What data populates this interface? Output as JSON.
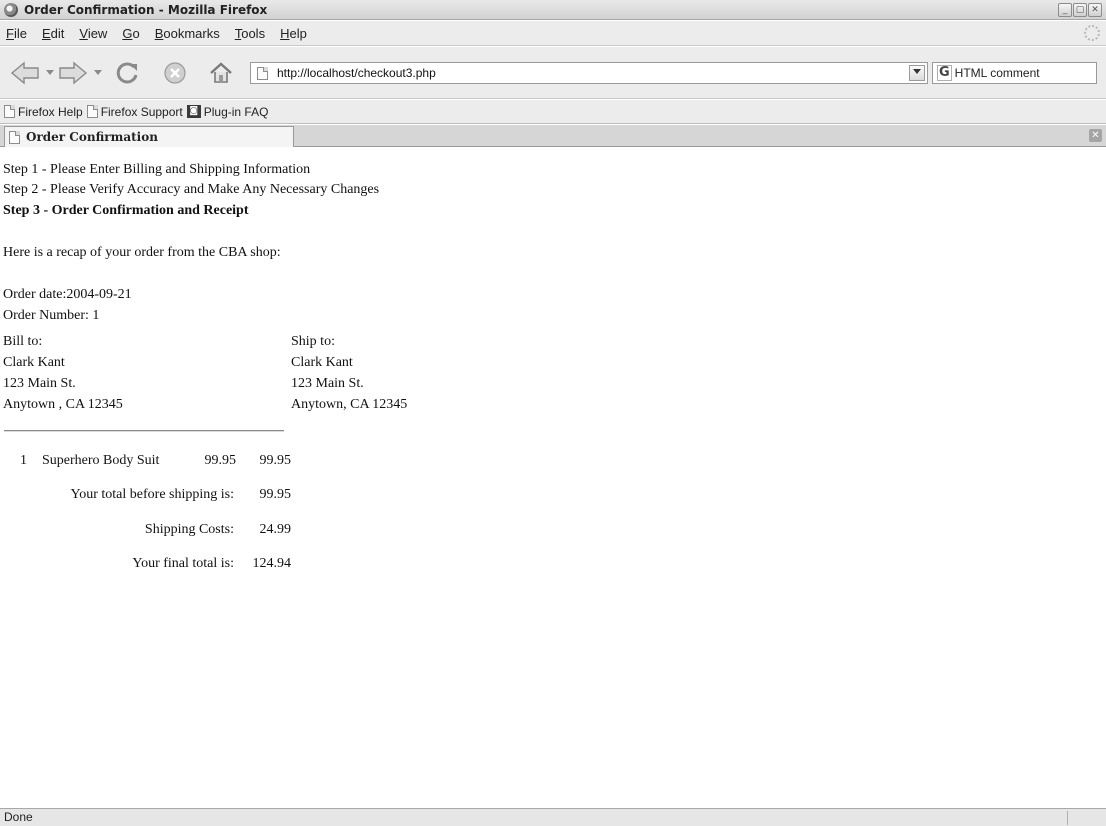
{
  "window": {
    "title": "Order Confirmation - Mozilla Firefox",
    "controls": [
      "_",
      "▢",
      "✕"
    ]
  },
  "menu": [
    {
      "hot": "F",
      "rest": "ile"
    },
    {
      "hot": "E",
      "rest": "dit"
    },
    {
      "hot": "V",
      "rest": "iew"
    },
    {
      "hot": "G",
      "rest": "o"
    },
    {
      "hot": "B",
      "rest": "ookmarks"
    },
    {
      "hot": "T",
      "rest": "ools"
    },
    {
      "hot": "H",
      "rest": "elp"
    }
  ],
  "nav": {
    "url": "http://localhost/checkout3.php",
    "search_engine_glyph": "G",
    "search_text": "HTML comment"
  },
  "bookmarks": [
    {
      "label": "Firefox Help",
      "icon": "page-icon"
    },
    {
      "label": "Firefox Support",
      "icon": "page-icon"
    },
    {
      "label": "Plug-in FAQ",
      "icon": "plugin-icon"
    }
  ],
  "tab": {
    "label": "Order Confirmation",
    "close": "✕"
  },
  "page": {
    "step1": "Step 1 - Please Enter Billing and Shipping Information",
    "step2": "Step 2 - Please Verify Accuracy and Make Any Necessary Changes",
    "step3": "Step 3 - Order Confirmation and Receipt",
    "intro": "Here is a recap of your order from the CBA shop:",
    "order_date": "Order date:2004-09-21",
    "order_number": "Order Number: 1",
    "bill_to": {
      "heading": "Bill to:",
      "name": "Clark Kant",
      "street": "123 Main St.",
      "city": "Anytown , CA 12345"
    },
    "ship_to": {
      "heading": "Ship to:",
      "name": "Clark Kant",
      "street": "123 Main St.",
      "city": "Anytown, CA 12345"
    },
    "item": {
      "qty": "1",
      "name": "Superhero Body Suit",
      "price": "99.95",
      "total": "99.95"
    },
    "subtotal_label": "Your total before shipping is:",
    "subtotal_value": "99.95",
    "shipping_label": "Shipping Costs:",
    "shipping_value": "24.99",
    "final_label": "Your final total is:",
    "final_value": "124.94"
  },
  "status": {
    "text": "Done"
  }
}
